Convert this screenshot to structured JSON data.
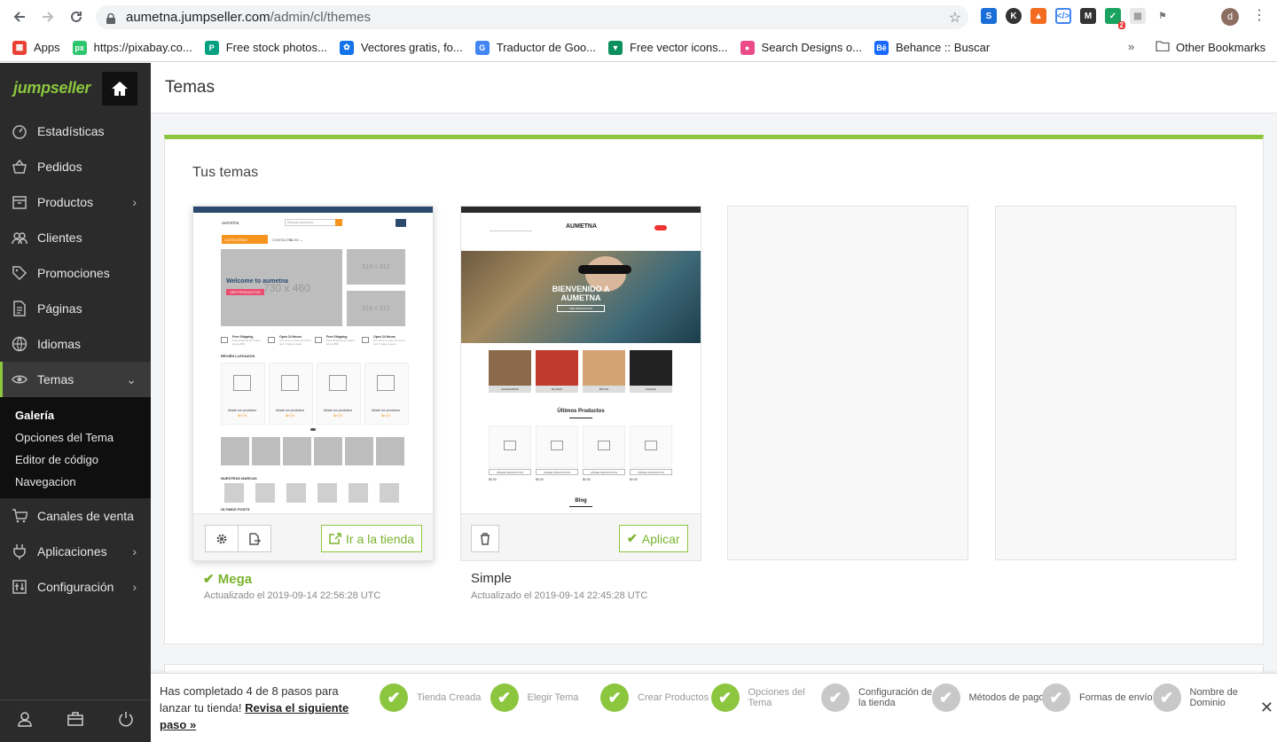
{
  "browser": {
    "url_host": "aumetna.jumpseller.com",
    "url_path": "/admin/cl/themes",
    "bookmarks": [
      {
        "label": "Apps",
        "color": "#e94235",
        "glyph": "▦"
      },
      {
        "label": "https://pixabay.co...",
        "color": "#2ec66d",
        "glyph": "px"
      },
      {
        "label": "Free stock photos...",
        "color": "#05a081",
        "glyph": "P"
      },
      {
        "label": "Vectores gratis, fo...",
        "color": "#1273eb",
        "glyph": "✿"
      },
      {
        "label": "Traductor de Goo...",
        "color": "#4285f4",
        "glyph": "G"
      },
      {
        "label": "Free vector icons...",
        "color": "#0a8f5f",
        "glyph": "▼"
      },
      {
        "label": "Search Designs o...",
        "color": "#ea4c89",
        "glyph": "●"
      },
      {
        "label": "Behance :: Buscar",
        "color": "#1769ff",
        "glyph": "Bē"
      }
    ],
    "other_bookmarks": "Other Bookmarks",
    "more": "»",
    "ext_badge": "2",
    "profile_initial": "d"
  },
  "sidebar": {
    "logo": "jumpseller",
    "items": [
      {
        "label": "Estadísticas",
        "icon": "gauge-icon"
      },
      {
        "label": "Pedidos",
        "icon": "basket-icon"
      },
      {
        "label": "Productos",
        "icon": "box-icon",
        "chevron": "›"
      },
      {
        "label": "Clientes",
        "icon": "users-icon"
      },
      {
        "label": "Promociones",
        "icon": "tag-icon"
      },
      {
        "label": "Páginas",
        "icon": "document-icon"
      },
      {
        "label": "Idiomas",
        "icon": "globe-icon"
      },
      {
        "label": "Temas",
        "icon": "eye-icon",
        "chevron": "⌄"
      }
    ],
    "submenu": [
      "Galería",
      "Opciones del Tema",
      "Editor de código",
      "Navegacion"
    ],
    "items_after": [
      {
        "label": "Canales de venta",
        "icon": "cart-icon"
      },
      {
        "label": "Aplicaciones",
        "icon": "plug-icon",
        "chevron": "›"
      },
      {
        "label": "Configuración",
        "icon": "settings-icon",
        "chevron": "›"
      }
    ]
  },
  "header": {
    "title": "Temas"
  },
  "panel": {
    "title": "Tus temas",
    "themes": [
      {
        "name": "Mega",
        "updated": "Actualizado el 2019-09-14 22:56:28 UTC",
        "action": "Ir a la tienda",
        "active": true
      },
      {
        "name": "Simple",
        "updated": "Actualizado el 2019-09-14 22:45:28 UTC",
        "action": "Aplicar",
        "active": false
      }
    ]
  },
  "mega_preview": {
    "brand": "aumetna",
    "search": "Buscar producto",
    "categories": "CATEGORÍAS",
    "nav": [
      "CONTACTO",
      "BLOG ⌄"
    ],
    "hero_title": "Welcome to aumetna",
    "hero_button": "VER PRODUCTOS",
    "hero_size": "730 x 460",
    "side_size": "510 x 312",
    "features": [
      {
        "title": "Free Shipping",
        "text": "Free shipping for orders above $50"
      },
      {
        "title": "Open 24 Hours",
        "text": "Our store is open 24 hours and 7 days a week"
      },
      {
        "title": "Free Shipping",
        "text": "Free shipping for orders above $50"
      },
      {
        "title": "Open 24 Hours",
        "text": "Our store is open 24 hours and 7 days a week"
      }
    ],
    "recent_label": "RECIÉN LLEGADOS",
    "product_label": "Añade tus productos",
    "price": "$0.00",
    "brands_label": "NUESTRAS MARCAS",
    "posts_label": "ÚLTIMOS POSTS"
  },
  "simple_preview": {
    "brand": "AUMETNA",
    "hero_title": "BIENVENIDO A AUMETNA",
    "hero_button": "VER PRODUCTOS",
    "categories": [
      "ACCESORIOS",
      "BLUSAS",
      "BOLSO",
      "FALDAS"
    ],
    "latest": "Últimos Productos",
    "product_label": "AÑADE PRODUCTOS",
    "price": "$0.00",
    "blog": "Blog"
  },
  "progress": {
    "text_prefix": "Has completado 4 de 8 pasos para lanzar tu tienda! ",
    "link": "Revisa el siguiente paso »",
    "steps": [
      {
        "label": "Tienda Creada",
        "done": true
      },
      {
        "label": "Elegir Tema",
        "done": true
      },
      {
        "label": "Crear Productos",
        "done": true
      },
      {
        "label": "Opciones del Tema",
        "done": true
      },
      {
        "label": "Configuración de la tienda",
        "done": false
      },
      {
        "label": "Métodos de pago",
        "done": false
      },
      {
        "label": "Formas de envío",
        "done": false
      },
      {
        "label": "Nombre de Dominio",
        "done": false
      }
    ],
    "close": "✕"
  },
  "colors": {
    "brand_green": "#8cc63f",
    "sidebar_bg": "#2b2b2b",
    "accent_orange": "#f7941d"
  }
}
